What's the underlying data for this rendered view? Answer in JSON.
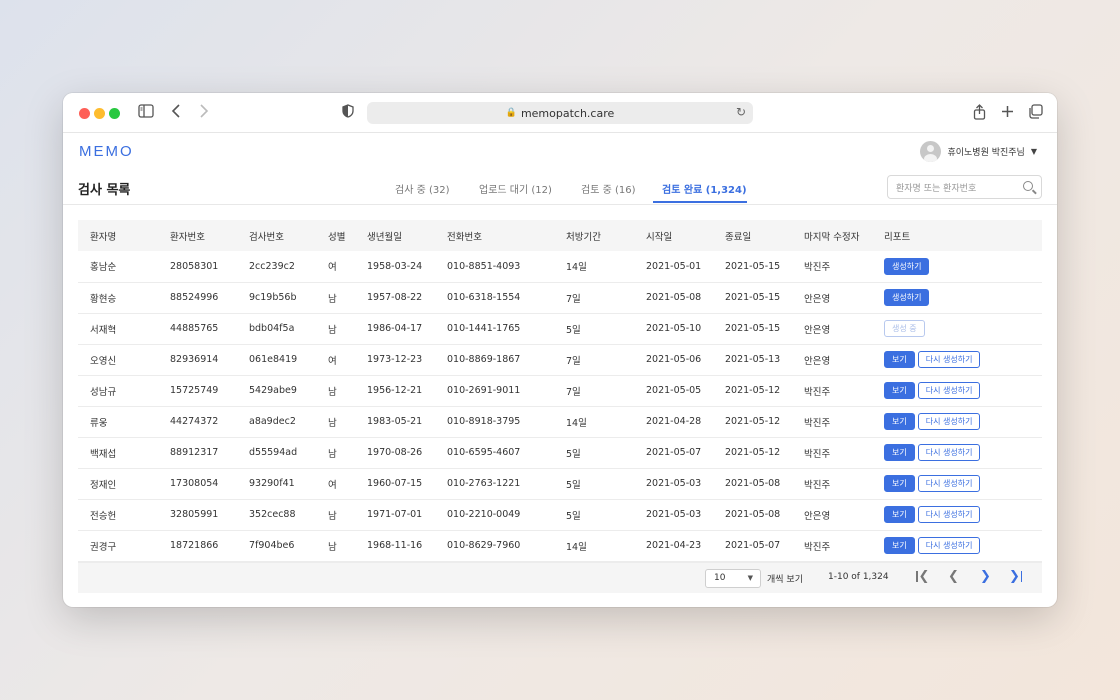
{
  "browser": {
    "url": "memopatch.care"
  },
  "app": {
    "logo": "MEMO",
    "user_name": "휴이노병원 박진주님"
  },
  "page": {
    "title": "검사 목록"
  },
  "tabs": [
    {
      "label": "검사 중 (32)"
    },
    {
      "label": "업로드 대기 (12)"
    },
    {
      "label": "검토 중 (16)"
    },
    {
      "label": "검토 완료 (1,324)"
    }
  ],
  "search": {
    "placeholder": "환자명 또는 환자번호"
  },
  "table": {
    "headers": [
      "환자명",
      "환자번호",
      "검사번호",
      "성별",
      "생년월일",
      "전화번호",
      "처방기간",
      "시작일",
      "종료일",
      "마지막 수정자",
      "리포트"
    ],
    "rows": [
      [
        "홍남순",
        "28058301",
        "2cc239c2",
        "여",
        "1958-03-24",
        "010-8851-4093",
        "14일",
        "2021-05-01",
        "2021-05-15",
        "박진주"
      ],
      [
        "황현승",
        "88524996",
        "9c19b56b",
        "남",
        "1957-08-22",
        "010-6318-1554",
        "7일",
        "2021-05-08",
        "2021-05-15",
        "안은영"
      ],
      [
        "서재혁",
        "44885765",
        "bdb04f5a",
        "남",
        "1986-04-17",
        "010-1441-1765",
        "5일",
        "2021-05-10",
        "2021-05-15",
        "안은영"
      ],
      [
        "오영신",
        "82936914",
        "061e8419",
        "여",
        "1973-12-23",
        "010-8869-1867",
        "7일",
        "2021-05-06",
        "2021-05-13",
        "안은영"
      ],
      [
        "성남규",
        "15725749",
        "5429abe9",
        "남",
        "1956-12-21",
        "010-2691-9011",
        "7일",
        "2021-05-05",
        "2021-05-12",
        "박진주"
      ],
      [
        "류웅",
        "44274372",
        "a8a9dec2",
        "남",
        "1983-05-21",
        "010-8918-3795",
        "14일",
        "2021-04-28",
        "2021-05-12",
        "박진주"
      ],
      [
        "백재섭",
        "88912317",
        "d55594ad",
        "남",
        "1970-08-26",
        "010-6595-4607",
        "5일",
        "2021-05-07",
        "2021-05-12",
        "박진주"
      ],
      [
        "정재인",
        "17308054",
        "93290f41",
        "여",
        "1960-07-15",
        "010-2763-1221",
        "5일",
        "2021-05-03",
        "2021-05-08",
        "박진주"
      ],
      [
        "전승헌",
        "32805991",
        "352cec88",
        "남",
        "1971-07-01",
        "010-2210-0049",
        "5일",
        "2021-05-03",
        "2021-05-08",
        "안은영"
      ],
      [
        "권경구",
        "18721866",
        "7f904be6",
        "남",
        "1968-11-16",
        "010-8629-7960",
        "14일",
        "2021-04-23",
        "2021-05-07",
        "박진주"
      ]
    ],
    "report_actions": [
      "create",
      "create",
      "generating",
      "view",
      "view",
      "view",
      "view",
      "view",
      "view",
      "view"
    ]
  },
  "report_labels": {
    "create": "생성하기",
    "generating": "생성 중",
    "view": "보기",
    "regenerate": "다시 생성하기"
  },
  "pagination": {
    "per_page": "10",
    "per_page_label": "개씩 보기",
    "range": "1-10 of 1,324"
  },
  "colors": {
    "accent": "#3b6fe0"
  }
}
